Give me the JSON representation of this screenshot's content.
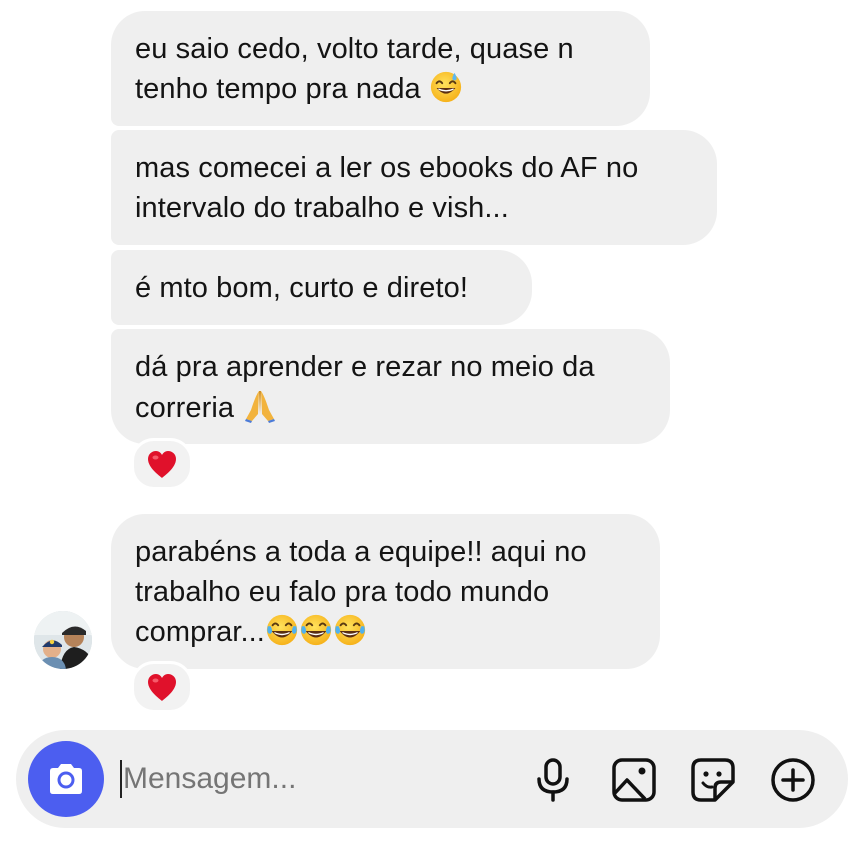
{
  "messages": [
    {
      "lines": [
        "eu saio cedo, volto tarde, quase n",
        "tenho tempo pra nada"
      ],
      "emoji": "sweat-smile-emoji"
    },
    {
      "lines": [
        "mas comecei a ler os ebooks do AF no",
        "intervalo do trabalho e vish..."
      ]
    },
    {
      "lines": [
        "é mto bom, curto e direto!"
      ]
    },
    {
      "lines": [
        "dá pra aprender e rezar no meio da",
        "correria"
      ],
      "emoji": "folded-hands-emoji",
      "reaction": "heart-reaction"
    },
    {
      "lines": [
        "parabéns a toda a equipe!! aqui no",
        "trabalho eu falo pra todo mundo",
        "comprar..."
      ],
      "emoji": "laughing-tears-emoji x3",
      "reaction": "heart-reaction"
    }
  ],
  "composer": {
    "placeholder": "Mensagem...",
    "icons": [
      "camera-icon",
      "microphone-icon",
      "gallery-icon",
      "sticker-icon",
      "plus-circle-icon"
    ]
  },
  "colors": {
    "bubble": "#efefef",
    "camera_button": "#4c5ef0",
    "heart": "#e0112b"
  }
}
